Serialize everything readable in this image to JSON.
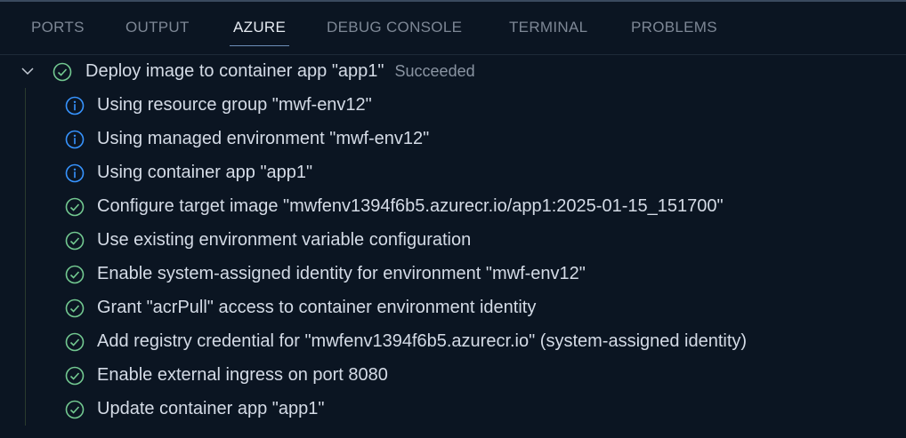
{
  "tabs": [
    {
      "label": "PORTS",
      "active": false
    },
    {
      "label": "OUTPUT",
      "active": false
    },
    {
      "label": "AZURE",
      "active": true
    },
    {
      "label": "DEBUG CONSOLE",
      "active": false
    },
    {
      "label": "TERMINAL",
      "active": false
    },
    {
      "label": "PROBLEMS",
      "active": false
    }
  ],
  "colors": {
    "success": "#73c991",
    "info": "#3794ff",
    "background": "#0b1522"
  },
  "tree": {
    "parent": {
      "label": "Deploy image to container app \"app1\"",
      "status": "Succeeded",
      "icon": "check-circle-icon",
      "expanded": true
    },
    "children": [
      {
        "label": "Using resource group \"mwf-env12\"",
        "icon": "info"
      },
      {
        "label": "Using managed environment \"mwf-env12\"",
        "icon": "info"
      },
      {
        "label": "Using container app \"app1\"",
        "icon": "info"
      },
      {
        "label": "Configure target image \"mwfenv1394f6b5.azurecr.io/app1:2025-01-15_151700\"",
        "icon": "check"
      },
      {
        "label": "Use existing environment variable configuration",
        "icon": "check"
      },
      {
        "label": "Enable system-assigned identity for environment \"mwf-env12\"",
        "icon": "check"
      },
      {
        "label": "Grant \"acrPull\" access to container environment identity",
        "icon": "check"
      },
      {
        "label": "Add registry credential for \"mwfenv1394f6b5.azurecr.io\" (system-assigned identity)",
        "icon": "check"
      },
      {
        "label": "Enable external ingress on port 8080",
        "icon": "check"
      },
      {
        "label": "Update container app \"app1\"",
        "icon": "check"
      }
    ]
  }
}
